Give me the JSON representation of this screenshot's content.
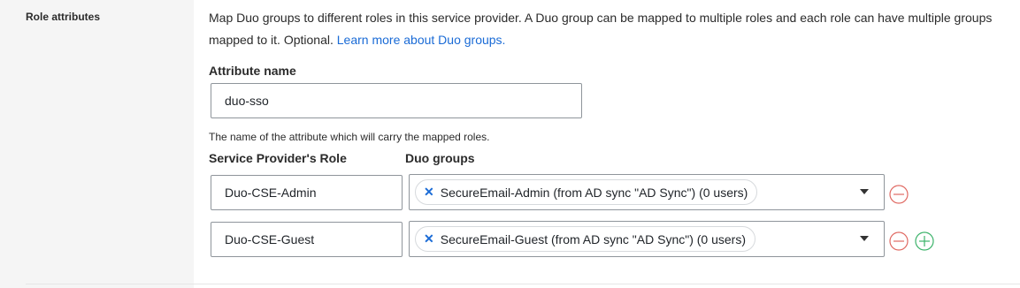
{
  "section": {
    "label": "Role attributes",
    "description": "Map Duo groups to different roles in this service provider. A Duo group can be mapped to multiple roles and each role can have multiple groups mapped to it. Optional. ",
    "link_text": "Learn more about Duo groups."
  },
  "attribute": {
    "label": "Attribute name",
    "value": "duo-sso",
    "help": "The name of the attribute which will carry the mapped roles."
  },
  "table": {
    "role_header": "Service Provider's Role",
    "groups_header": "Duo groups",
    "rows": [
      {
        "role": "Duo-CSE-Admin",
        "group": "SecureEmail-Admin (from AD sync \"AD Sync\") (0 users)"
      },
      {
        "role": "Duo-CSE-Guest",
        "group": "SecureEmail-Guest (from AD sync \"AD Sync\") (0 users)"
      }
    ]
  },
  "icons": {
    "chip_remove": "close-icon",
    "dropdown": "chevron-down-icon",
    "remove_row": "minus-circle-icon",
    "add_row": "plus-circle-icon"
  },
  "colors": {
    "link": "#1a6bd6",
    "remove": "#e06a63",
    "add": "#3db36b",
    "rail": "#f5f5f5"
  }
}
